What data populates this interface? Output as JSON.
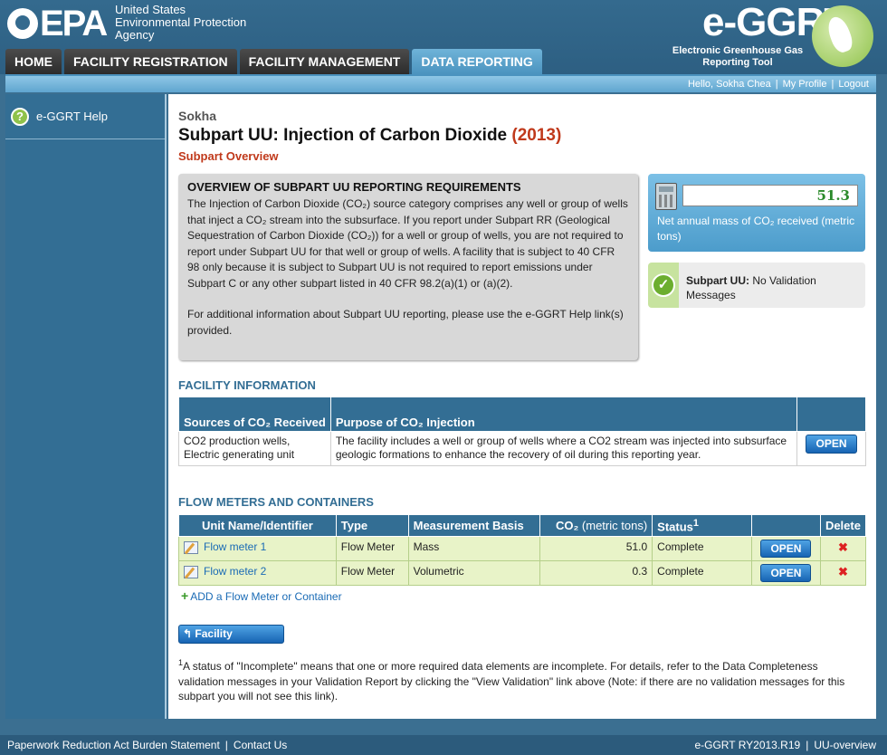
{
  "header": {
    "epa_letters": "EPA",
    "agency_line1": "United States",
    "agency_line2": "Environmental Protection",
    "agency_line3": "Agency",
    "brand_title": "e-GGRT",
    "brand_sub1": "Electronic Greenhouse Gas",
    "brand_sub2": "Reporting Tool"
  },
  "nav": {
    "tabs": [
      {
        "label": "HOME"
      },
      {
        "label": "FACILITY REGISTRATION"
      },
      {
        "label": "FACILITY MANAGEMENT"
      },
      {
        "label": "DATA REPORTING"
      }
    ]
  },
  "userbar": {
    "greeting": "Hello, Sokha Chea",
    "profile": "My Profile",
    "logout": "Logout",
    "sep": "|"
  },
  "sidebar": {
    "help_icon": "?",
    "help_label": "e-GGRT Help"
  },
  "main": {
    "facility_name": "Sokha",
    "title": "Subpart UU: Injection of Carbon Dioxide",
    "year": "(2013)",
    "subtitle": "Subpart Overview",
    "overview": {
      "heading": "OVERVIEW OF SUBPART UU REPORTING REQUIREMENTS",
      "p1": "The Injection of Carbon Dioxide (CO₂) source category comprises any well or group of wells that inject a CO₂ stream into the subsurface. If you report under Subpart RR (Geological Sequestration of Carbon Dioxide (CO₂)) for a well or group of wells, you are not required to report under Subpart UU for that well or group of wells. A facility that is subject to 40 CFR 98 only because it is subject to Subpart UU is not required to report emissions under Subpart C or any other subpart listed in 40 CFR 98.2(a)(1) or (a)(2).",
      "p2": "For additional information about Subpart UU reporting, please use the e-GGRT Help link(s) provided."
    },
    "mass": {
      "value": "51.3",
      "label": "Net annual mass of CO₂ received (metric tons)"
    },
    "validation": {
      "check": "✓",
      "bold": "Subpart UU:",
      "text": "No Validation Messages"
    },
    "facility_info": {
      "title": "FACILITY INFORMATION",
      "headers": [
        "Sources of CO₂ Received",
        "Purpose of CO₂ Injection",
        ""
      ],
      "row": {
        "sources": "CO2 production wells, Electric generating unit",
        "purpose": "The facility includes a well or group of wells where a CO2 stream was injected into subsurface geologic formations to enhance the recovery of oil during this reporting year.",
        "action": "OPEN"
      }
    },
    "flow_meters": {
      "title": "FLOW METERS AND CONTAINERS",
      "headers": {
        "unit": "Unit Name/Identifier",
        "type": "Type",
        "basis": "Measurement Basis",
        "co2_main": "CO₂",
        "co2_unit": "(metric tons)",
        "status": "Status",
        "status_sup": "1",
        "action": "",
        "delete": "Delete"
      },
      "rows": [
        {
          "name": "Flow meter 1",
          "type": "Flow Meter",
          "basis": "Mass",
          "co2": "51.0",
          "status": "Complete",
          "action": "OPEN",
          "delete": "✖"
        },
        {
          "name": "Flow meter 2",
          "type": "Flow Meter",
          "basis": "Volumetric",
          "co2": "0.3",
          "status": "Complete",
          "action": "OPEN",
          "delete": "✖"
        }
      ],
      "add_plus": "+",
      "add_label": "ADD a Flow Meter or Container"
    },
    "overview_button": "Facility Overview",
    "overview_button_arrow": "↰",
    "footnote_sup": "1",
    "footnote": "A status of \"Incomplete\" means that one or more required data elements are incomplete. For details, refer to the Data Completeness validation messages in your Validation Report by clicking the \"View Validation\" link above (Note: if there are no validation messages for this subpart you will not see this link)."
  },
  "footer": {
    "left1": "Paperwork Reduction Act Burden Statement",
    "left2": "Contact Us",
    "right1": "e-GGRT RY2013.R19",
    "right2": "UU-overview",
    "sep": "|"
  }
}
